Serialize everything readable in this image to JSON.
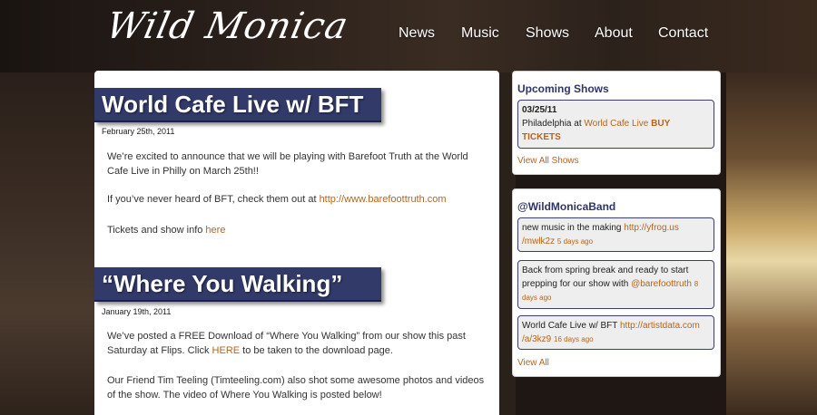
{
  "header": {
    "logo_text": "Wild Monica",
    "nav": [
      "News",
      "Music",
      "Shows",
      "About",
      "Contact"
    ]
  },
  "posts": [
    {
      "title": "World Cafe Live w/ BFT",
      "date": "February 25th, 2011",
      "p1": "We’re excited to announce that we will be playing with Barefoot Truth at the World Cafe Live in Philly on March 25th!!",
      "p2_text": "If you’ve never heard of BFT, check them out at ",
      "p2_link": "http://www.barefoottruth.com",
      "p3_text": "Tickets and show info ",
      "p3_link": "here"
    },
    {
      "title": "“Where You Walking”",
      "date": "January 19th, 2011",
      "p1_text": "We’ve posted a FREE Download of “Where You Walking” from our show this past Saturday at Flips. Click ",
      "p1_link": "HERE",
      "p1_tail": " to be taken to the download page.",
      "p2": "Our Friend Tim Teeling (Timteeling.com) also shot some awesome photos and videos of the show. The video of Where You Walking is posted below!"
    }
  ],
  "sidebar": {
    "shows": {
      "title": "Upcoming Shows",
      "date": "03/25/11",
      "city": "Philadelphia at ",
      "venue": "World Cafe Live",
      "buy_1": "BUY",
      "buy_2": "TICKETS",
      "view_all": "View All Shows"
    },
    "twitter": {
      "title": "@WildMonicaBand",
      "tweets": [
        {
          "text": "new music in the making ",
          "link_1": "http://yfrog.us",
          "link_2": "/mwlk2z",
          "ago": "5 days ago"
        },
        {
          "text_1": "Back from spring break and ready to start",
          "text_2": "prepping for our show with ",
          "link": "@barefoottruth",
          "ago_1": "8",
          "ago_2": "days ago"
        },
        {
          "text": "World Cafe Live w/ BFT ",
          "link_1": "http://artistdata.com",
          "link_2": "/a/3kz9",
          "ago": "16 days ago"
        }
      ],
      "view_all": "View All"
    }
  }
}
